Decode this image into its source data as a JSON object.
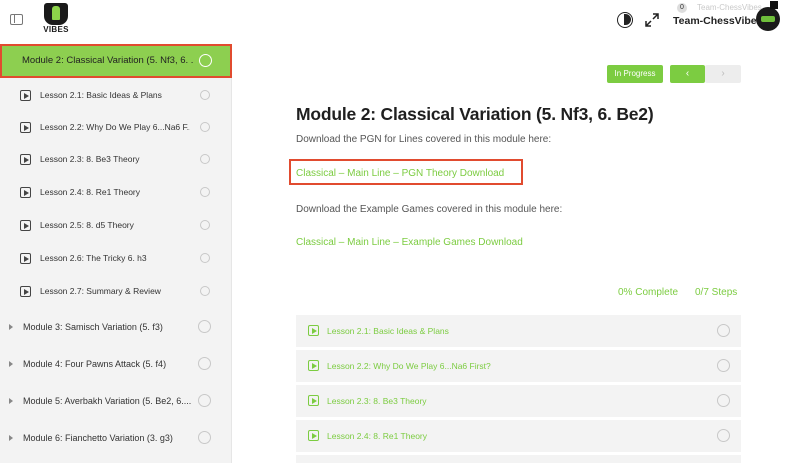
{
  "header": {
    "logo_text": "VIBES",
    "notification_count": "0",
    "user_name_faint": "Team-ChessVibes",
    "user_name": "Team-ChessVibes"
  },
  "sidebar": {
    "active_module": "Module 2: Classical Variation (5. Nf3, 6. ...",
    "lessons": [
      "Lesson 2.1: Basic Ideas & Plans",
      "Lesson 2.2: Why Do We Play 6...Na6 F...",
      "Lesson 2.3: 8. Be3 Theory",
      "Lesson 2.4: 8. Re1 Theory",
      "Lesson 2.5: 8. d5 Theory",
      "Lesson 2.6: The Tricky 6. h3",
      "Lesson 2.7: Summary & Review"
    ],
    "modules": [
      "Module 3: Samisch Variation (5. f3)",
      "Module 4: Four Pawns Attack (5. f4)",
      "Module 5: Averbakh Variation (5. Be2, 6....",
      "Module 6: Fianchetto Variation (3. g3)"
    ]
  },
  "main": {
    "status_label": "In Progress",
    "prev_label": "‹",
    "next_label": "›",
    "title": "Module 2: Classical Variation (5. Nf3, 6. Be2)",
    "pgn_text": "Download the PGN for Lines covered in this module here:",
    "pgn_link": "Classical – Main Line – PGN Theory Download",
    "games_text": "Download the Example Games covered in this module here:",
    "games_link": "Classical – Main Line – Example Games Download",
    "progress_percent": "0% Complete",
    "progress_steps": "0/7 Steps",
    "steps": [
      "Lesson 2.1: Basic Ideas & Plans",
      "Lesson 2.2: Why Do We Play 6...Na6 First?",
      "Lesson 2.3: 8. Be3 Theory",
      "Lesson 2.4: 8. Re1 Theory"
    ]
  },
  "colors": {
    "accent": "#7ccc41",
    "active_module_bg": "#8dcf50",
    "highlight_border": "#e14b2f"
  }
}
